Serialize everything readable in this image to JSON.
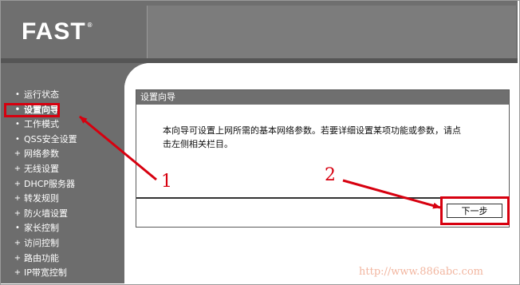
{
  "brand": {
    "logo": "FAST",
    "trademark": "®"
  },
  "sidebar": {
    "items": [
      {
        "label": "运行状态",
        "bullet": "•"
      },
      {
        "label": "设置向导",
        "bullet": "•",
        "active": true
      },
      {
        "label": "工作模式",
        "bullet": "•"
      },
      {
        "label": "QSS安全设置",
        "bullet": "•"
      },
      {
        "label": "网络参数",
        "bullet": "+"
      },
      {
        "label": "无线设置",
        "bullet": "+"
      },
      {
        "label": "DHCP服务器",
        "bullet": "+"
      },
      {
        "label": "转发规则",
        "bullet": "+"
      },
      {
        "label": "防火墙设置",
        "bullet": "+"
      },
      {
        "label": "家长控制",
        "bullet": "•"
      },
      {
        "label": "访问控制",
        "bullet": "+"
      },
      {
        "label": "路由功能",
        "bullet": "+"
      },
      {
        "label": "IP带宽控制",
        "bullet": "+"
      }
    ]
  },
  "panel": {
    "title": "设置向导",
    "body_line1": "本向导可设置上网所需的基本网络参数。若要详细设置某项功能或参数，请点",
    "body_line2": "击左侧相关栏目。",
    "next_button": "下一步"
  },
  "annotations": {
    "step1": "1",
    "step2": "2"
  },
  "watermark": "http://www.886abc.com",
  "colors": {
    "highlight": "#d7000f",
    "header": "#6f6f6f",
    "sidebar": "#6d6d6d"
  }
}
